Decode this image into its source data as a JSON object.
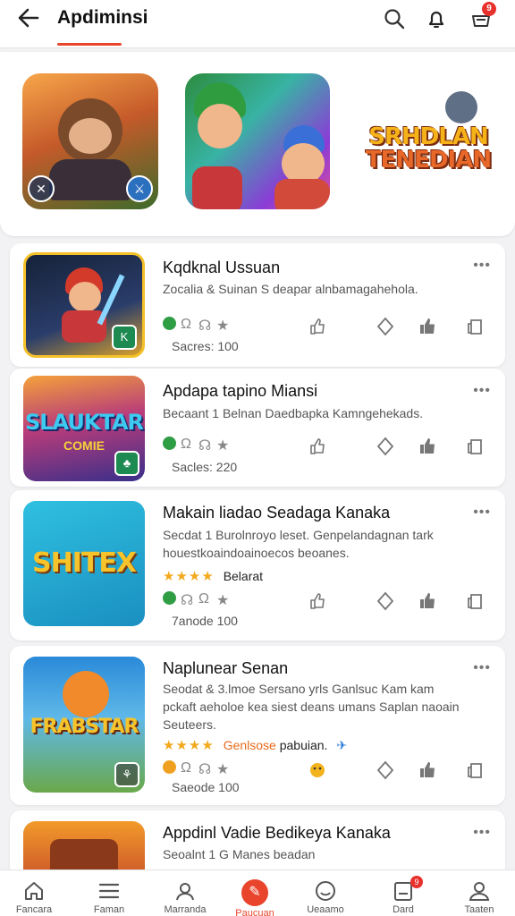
{
  "header": {
    "title": "Apdiminsi",
    "back_icon": "arrow-left-icon",
    "badge_count": "9"
  },
  "colors": {
    "accent": "#e8452c",
    "star": "#f2a91c",
    "green": "#2f9d44"
  },
  "featured": {
    "logo_line1": "SRHDLAN",
    "logo_line2": "TENEDIAN"
  },
  "apps": [
    {
      "name": "Kqdknal Ussuan",
      "description": "Zocalia & Suinan S deapar alnbamagahehola.",
      "sales": "Sacres:  100"
    },
    {
      "name": "Apdapa tapino Miansi",
      "description": "Becaant 1 Belnan Daedbapka Kamngehekads.",
      "sales": "Sacles:  220",
      "thumb_title": "SLAUKTAR",
      "thumb_sub": "COMIE"
    },
    {
      "name": "Makain liadao Seadaga Kanaka",
      "description": "Secdat 1 Burolnroyo leset. Genpelandagnan tark houestkoaindoainoecos beoanes.",
      "stars": "★★★★",
      "rating_label": "Belarat",
      "sales": "7anode  100",
      "thumb_title": "SHITEX"
    },
    {
      "name": "Naplunear Senan",
      "description": "Seodat & 3.lmoe Sersano yrls Ganlsuc Kam kam pckaft aeholoe kea siest deans umans Saplan naoain Seuteers.",
      "stars": "★★★★",
      "rating_label": "Genlsose",
      "rating_label2": "pabuian.",
      "sales": "Saeode  100",
      "thumb_title": "FRABSTAR"
    },
    {
      "name": "Appdinl Vadie Bedikeya Kanaka",
      "description": "Seoalnt 1 G Manes beadan"
    }
  ],
  "bottom_nav": [
    {
      "label": "Fancara",
      "icon": "home-icon"
    },
    {
      "label": "Faman",
      "icon": "menu-icon"
    },
    {
      "label": "Marranda",
      "icon": "user-icon"
    },
    {
      "label": "Paucuan",
      "icon": "compass-icon"
    },
    {
      "label": "Ueaamo",
      "icon": "smiley-icon"
    },
    {
      "label": "Dard",
      "icon": "card-icon",
      "badge": "9"
    },
    {
      "label": "Taaten",
      "icon": "profile-icon"
    }
  ]
}
